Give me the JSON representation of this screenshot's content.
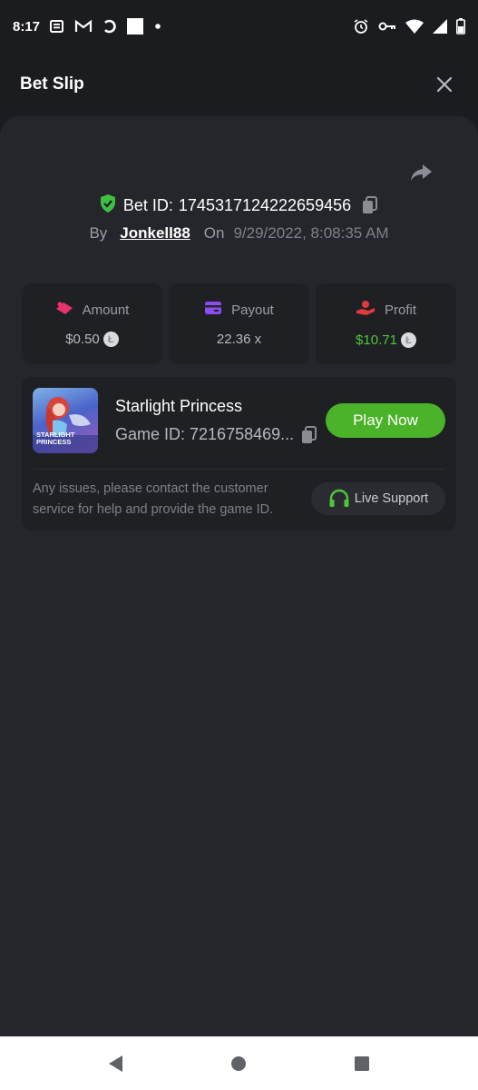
{
  "status_bar": {
    "time": "8:17",
    "left_icons": [
      "news-icon",
      "gmail-icon",
      "sync-icon",
      "square-icon",
      "dot-icon"
    ],
    "right_icons": [
      "alarm-icon",
      "vpn-key-icon",
      "wifi-icon",
      "signal-icon",
      "battery-icon"
    ]
  },
  "header": {
    "title": "Bet Slip",
    "close_icon": "close-icon"
  },
  "bet": {
    "id_label": "Bet ID:",
    "id_value": "1745317124222659456",
    "by_label": "By",
    "username": "Jonkell88",
    "on_label": "On",
    "date": "9/29/2022, 8:08:35 AM"
  },
  "stats": {
    "amount": {
      "label": "Amount",
      "value": "$0.50",
      "icon": "money-icon",
      "icon_color": "#e8336f"
    },
    "payout": {
      "label": "Payout",
      "value": "22.36 x",
      "icon": "card-icon",
      "icon_color": "#8b4cf0"
    },
    "profit": {
      "label": "Profit",
      "value": "$10.71",
      "icon": "hand-coin-icon",
      "icon_color": "#e23a3a",
      "value_color": "#4fc73a"
    },
    "coin_symbol": "Ł"
  },
  "game": {
    "name": "Starlight Princess",
    "id_text": "Game ID: 7216758469...",
    "play_label": "Play Now",
    "thumb_line1": "STARLIGHT",
    "thumb_line2": "PRINCESS",
    "issue_text": "Any issues, please contact the customer service for help and provide the game ID.",
    "support_label": "Live Support"
  },
  "colors": {
    "background": "#1b1c1f",
    "sheet": "#24262b",
    "card": "#1e2024",
    "accent_green": "#4bb32a"
  }
}
